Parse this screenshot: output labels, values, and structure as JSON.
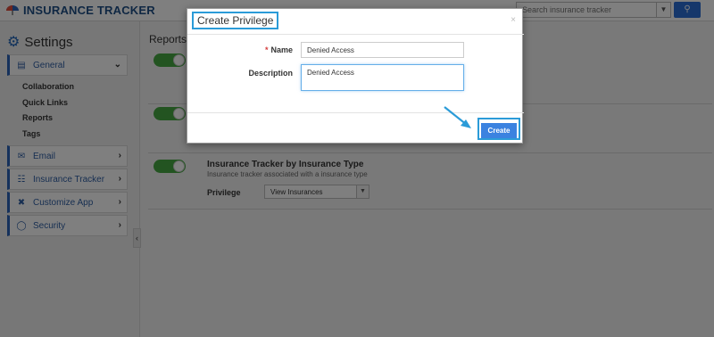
{
  "app": {
    "title": "INSURANCE TRACKER",
    "search_placeholder": "Search insurance tracker"
  },
  "sidebar": {
    "title": "Settings",
    "general_label": "General",
    "sub_items": [
      "Collaboration",
      "Quick Links",
      "Reports",
      "Tags"
    ],
    "items": [
      {
        "label": "Email"
      },
      {
        "label": "Insurance Tracker"
      },
      {
        "label": "Customize App"
      },
      {
        "label": "Security"
      }
    ]
  },
  "main": {
    "title": "Reports",
    "report": {
      "title": "Insurance Tracker by Insurance Type",
      "description": "Insurance tracker associated with a insurance type",
      "privilege_label": "Privilege",
      "privilege_value": "View Insurances"
    }
  },
  "modal": {
    "title": "Create Privilege",
    "close_glyph": "×",
    "name_label": "Name",
    "name_value": "Denied Access",
    "required_marker": "*",
    "description_label": "Description",
    "description_value": "Denied Access",
    "create_label": "Create"
  },
  "colors": {
    "accent": "#2b9bd8",
    "primary_button": "#3b82e0",
    "toggle_on": "#46a843"
  }
}
